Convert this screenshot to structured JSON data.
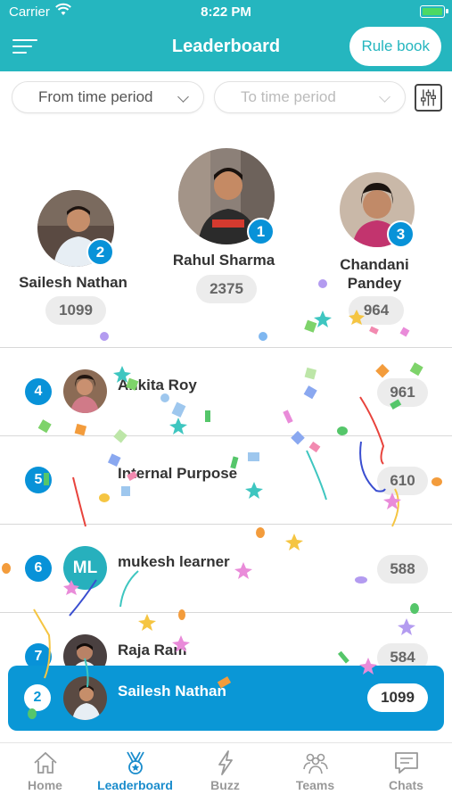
{
  "status_bar": {
    "carrier": "Carrier",
    "time": "8:22 PM"
  },
  "nav": {
    "title": "Leaderboard",
    "rule_book": "Rule book"
  },
  "filters": {
    "from_placeholder": "From time period",
    "to_placeholder": "To time period"
  },
  "podium": {
    "first": {
      "rank": "1",
      "name": "Rahul Sharma",
      "score": "2375"
    },
    "second": {
      "rank": "2",
      "name": "Sailesh Nathan",
      "score": "1099"
    },
    "third": {
      "rank": "3",
      "name": "Chandani Pandey",
      "score": "964"
    }
  },
  "rows": [
    {
      "rank": "4",
      "name": "Ankita Roy",
      "score": "961"
    },
    {
      "rank": "5",
      "name": "Internal Purpose",
      "score": "610"
    },
    {
      "rank": "6",
      "name": "mukesh learner",
      "score": "588",
      "initials": "ML"
    },
    {
      "rank": "7",
      "name": "Raja Ram",
      "score": "584"
    }
  ],
  "current_user": {
    "rank": "2",
    "name": "Sailesh Nathan",
    "score": "1099"
  },
  "tabs": [
    {
      "label": "Home",
      "icon": "home-icon"
    },
    {
      "label": "Leaderboard",
      "icon": "medal-icon",
      "active": true
    },
    {
      "label": "Buzz",
      "icon": "lightning-icon"
    },
    {
      "label": "Teams",
      "icon": "people-icon"
    },
    {
      "label": "Chats",
      "icon": "chat-icon"
    }
  ],
  "colors": {
    "header": "#25b6bf",
    "rank_badge": "#0892d8",
    "current_user_bar": "#0a97d6",
    "active_tab": "#1a8ccc"
  }
}
